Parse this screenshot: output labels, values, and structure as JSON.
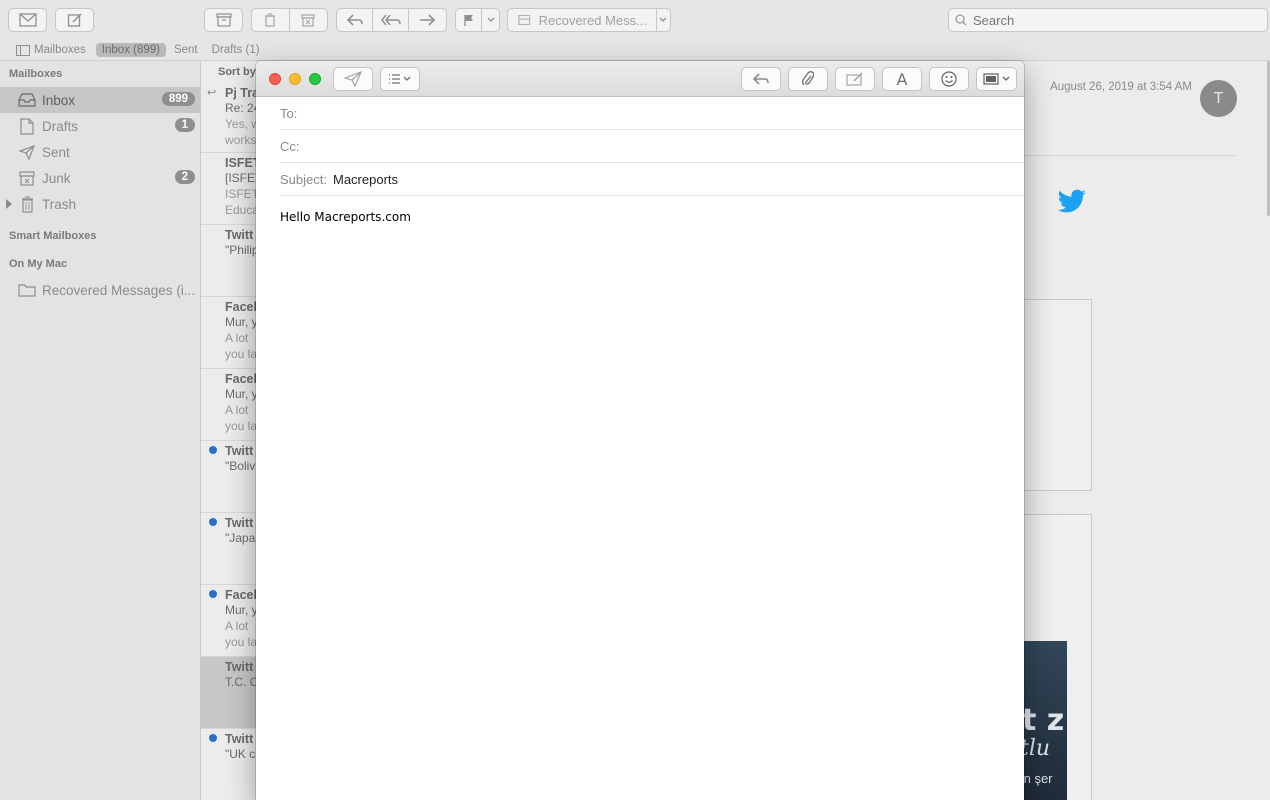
{
  "toolbar": {
    "move_label": "Recovered Mess...",
    "search_placeholder": "Search"
  },
  "favorites": {
    "mailboxes": "Mailboxes",
    "inbox": "Inbox (899)",
    "sent": "Sent",
    "drafts": "Drafts (1)"
  },
  "sidebar": {
    "section_mailboxes": "Mailboxes",
    "items": [
      {
        "label": "Inbox",
        "badge": "899"
      },
      {
        "label": "Drafts",
        "badge": "1"
      },
      {
        "label": "Sent",
        "badge": ""
      },
      {
        "label": "Junk",
        "badge": "2"
      },
      {
        "label": "Trash",
        "badge": ""
      }
    ],
    "section_smart": "Smart Mailboxes",
    "section_mac": "On My Mac",
    "mac_items": [
      {
        "label": "Recovered Messages (i..."
      }
    ]
  },
  "message_list": {
    "sort_label": "Sort by",
    "messages": [
      {
        "from": "Pj Tra",
        "subject": "Re: 24",
        "preview1": "Yes, w",
        "preview2": "works"
      },
      {
        "from": "ISFET",
        "subject": "[ISFET",
        "preview1": "ISFET",
        "preview2": "Educa"
      },
      {
        "from": "Twitt",
        "subject": "\"Philip",
        "preview1": "",
        "preview2": ""
      },
      {
        "from": "Faceb",
        "subject": "Mur, y",
        "preview1": " A lot",
        "preview2": "you la"
      },
      {
        "from": "Faceb",
        "subject": "Mur, y",
        "preview1": " A lot",
        "preview2": "you la"
      },
      {
        "from": "Twitt",
        "subject": "\"Boliv",
        "preview1": "",
        "preview2": ""
      },
      {
        "from": "Twitt",
        "subject": "\"Japa",
        "preview1": "",
        "preview2": ""
      },
      {
        "from": "Faceb",
        "subject": "Mur, y",
        "preview1": " A lot",
        "preview2": "you la"
      },
      {
        "from": "Twitt",
        "subject": "T.C. C",
        "preview1": "",
        "preview2": ""
      },
      {
        "from": "Twitt",
        "subject": "\"UK c",
        "preview1": "",
        "preview2": ""
      }
    ]
  },
  "reader": {
    "date": "August 26, 2019 at 3:54 AM",
    "avatar_initial": "T",
    "photo_text_1": "t z",
    "photo_text_2": "tlu",
    "photo_text_3": "ın şer"
  },
  "compose": {
    "to_label": "To:",
    "to_value": "",
    "cc_label": "Cc:",
    "cc_value": "",
    "subject_label": "Subject:",
    "subject_value": "Macreports",
    "body": "Hello Macreports.com"
  },
  "colors": {
    "unread_dot": "#2770c7",
    "close": "#fd5f57",
    "minimize": "#febc2e",
    "zoom": "#28c840",
    "twitter": "#1da1f2"
  }
}
